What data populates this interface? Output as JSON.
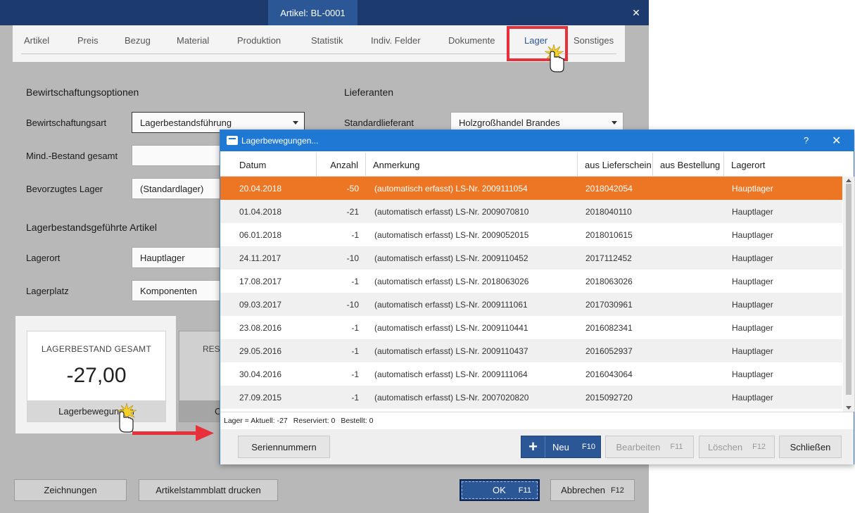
{
  "window": {
    "title": "Artikel: BL-0001",
    "close_glyph": "✕"
  },
  "tabs": [
    {
      "label": "Artikel"
    },
    {
      "label": "Preis"
    },
    {
      "label": "Bezug"
    },
    {
      "label": "Material"
    },
    {
      "label": "Produktion"
    },
    {
      "label": "Statistik"
    },
    {
      "label": "Indiv. Felder"
    },
    {
      "label": "Dokumente"
    },
    {
      "label": "Lager"
    },
    {
      "label": "Sonstiges"
    }
  ],
  "active_tab": "Lager",
  "bewirtschaftung": {
    "title": "Bewirtschaftungsoptionen",
    "art_label": "Bewirtschaftungsart",
    "art_value": "Lagerbestandsführung",
    "mindbestand_label": "Mind.-Bestand gesamt",
    "mindbestand_value": "",
    "lager_label": "Bevorzugtes Lager",
    "lager_value": "(Standardlager)"
  },
  "lieferanten": {
    "title": "Lieferanten",
    "standard_label": "Standardlieferant",
    "standard_value": "Holzgroßhandel Brandes"
  },
  "lagerbestand_artikel": {
    "title": "Lagerbestandsgeführte Artikel",
    "lagerort_label": "Lagerort",
    "lagerort_value": "Hauptlager",
    "lagerplatz_label": "Lagerplatz",
    "lagerplatz_value": "Komponenten"
  },
  "kpi": {
    "title": "LAGERBESTAND GESAMT",
    "value": "-27,00",
    "button_label": "Lagerbewegungen"
  },
  "kpi2": {
    "title": "RES",
    "button_label": "C"
  },
  "footer": {
    "zeichnungen": "Zeichnungen",
    "artikelstammblatt": "Artikelstammblatt drucken",
    "ok": "OK",
    "ok_fkey": "F11",
    "abbrechen": "Abbrechen",
    "abbrechen_fkey": "F12"
  },
  "dialog": {
    "title": "Lagerbewegungen...",
    "help_glyph": "?",
    "close_glyph": "✕",
    "columns": [
      "Datum",
      "Anzahl",
      "Anmerkung",
      "aus Lieferschein",
      "aus Bestellung",
      "Lagerort"
    ],
    "rows": [
      {
        "datum": "20.04.2018",
        "anzahl": "-50",
        "anmerkung": "(automatisch erfasst) LS-Nr. 2009111054",
        "lieferschein": "2018042054",
        "bestellung": "",
        "lagerort": "Hauptlager"
      },
      {
        "datum": "01.04.2018",
        "anzahl": "-21",
        "anmerkung": "(automatisch erfasst) LS-Nr. 2009070810",
        "lieferschein": "2018040110",
        "bestellung": "",
        "lagerort": "Hauptlager"
      },
      {
        "datum": "06.01.2018",
        "anzahl": "-1",
        "anmerkung": "(automatisch erfasst) LS-Nr. 2009052015",
        "lieferschein": "2018010615",
        "bestellung": "",
        "lagerort": "Hauptlager"
      },
      {
        "datum": "24.11.2017",
        "anzahl": "-10",
        "anmerkung": "(automatisch erfasst) LS-Nr. 2009110452",
        "lieferschein": "2017112452",
        "bestellung": "",
        "lagerort": "Hauptlager"
      },
      {
        "datum": "17.08.2017",
        "anzahl": "-1",
        "anmerkung": "(automatisch erfasst) LS-Nr. 2018063026",
        "lieferschein": "2018063026",
        "bestellung": "",
        "lagerort": "Hauptlager"
      },
      {
        "datum": "09.03.2017",
        "anzahl": "-10",
        "anmerkung": "(automatisch erfasst) LS-Nr. 2009111061",
        "lieferschein": "2017030961",
        "bestellung": "",
        "lagerort": "Hauptlager"
      },
      {
        "datum": "23.08.2016",
        "anzahl": "-1",
        "anmerkung": "(automatisch erfasst) LS-Nr. 2009110441",
        "lieferschein": "2016082341",
        "bestellung": "",
        "lagerort": "Hauptlager"
      },
      {
        "datum": "29.05.2016",
        "anzahl": "-1",
        "anmerkung": "(automatisch erfasst) LS-Nr. 2009110437",
        "lieferschein": "2016052937",
        "bestellung": "",
        "lagerort": "Hauptlager"
      },
      {
        "datum": "30.04.2016",
        "anzahl": "-1",
        "anmerkung": "(automatisch erfasst) LS-Nr. 2009111064",
        "lieferschein": "2016043064",
        "bestellung": "",
        "lagerort": "Hauptlager"
      },
      {
        "datum": "27.09.2015",
        "anzahl": "-1",
        "anmerkung": "(automatisch erfasst) LS-Nr. 2007020820",
        "lieferschein": "2015092720",
        "bestellung": "",
        "lagerort": "Hauptlager"
      }
    ],
    "selected_row": 0,
    "status": {
      "lager": "Lager = Aktuell: -27",
      "reserviert": "Reserviert: 0",
      "bestellt": "Bestellt: 0"
    },
    "buttons": {
      "seriennummern": "Seriennummern",
      "neu": "Neu",
      "neu_fkey": "F10",
      "bearbeiten": "Bearbeiten",
      "bearbeiten_fkey": "F11",
      "loeschen": "Löschen",
      "loeschen_fkey": "F12",
      "schliessen": "Schließen"
    }
  },
  "colors": {
    "title_bar": "#1d3a6e",
    "accent": "#2b5797",
    "dialog_title": "#1e78d4",
    "selected_row": "#ed7624",
    "highlight": "#e8303a"
  }
}
